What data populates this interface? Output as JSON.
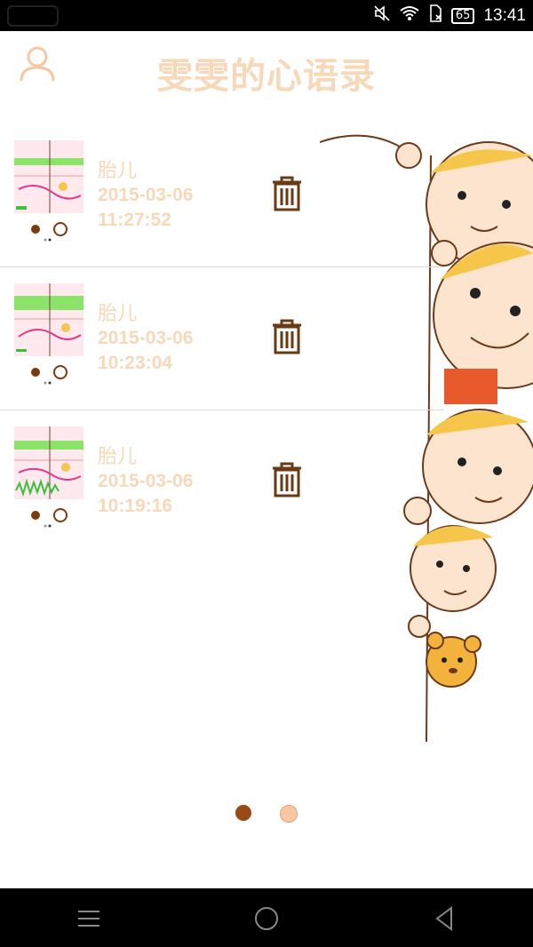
{
  "status_bar": {
    "time": "13:41",
    "battery": "65"
  },
  "header": {
    "title": "雯雯的心语录"
  },
  "records": [
    {
      "label": "胎儿",
      "date": "2015-03-06",
      "time": "11:27:52"
    },
    {
      "label": "胎儿",
      "date": "2015-03-06",
      "time": "10:23:04"
    },
    {
      "label": "胎儿",
      "date": "2015-03-06",
      "time": "10:19:16"
    }
  ],
  "pager": {
    "count": 2,
    "active_index": 0
  },
  "colors": {
    "accent_text": "#f7d8b8",
    "icon_brown": "#6a3a12",
    "dot_active": "#9a4a16",
    "dot_inactive": "#f7c7a2"
  },
  "icons": {
    "user": "user-icon",
    "trash": "trash-icon",
    "menu": "menu-icon",
    "home": "home-icon",
    "back": "back-icon"
  }
}
